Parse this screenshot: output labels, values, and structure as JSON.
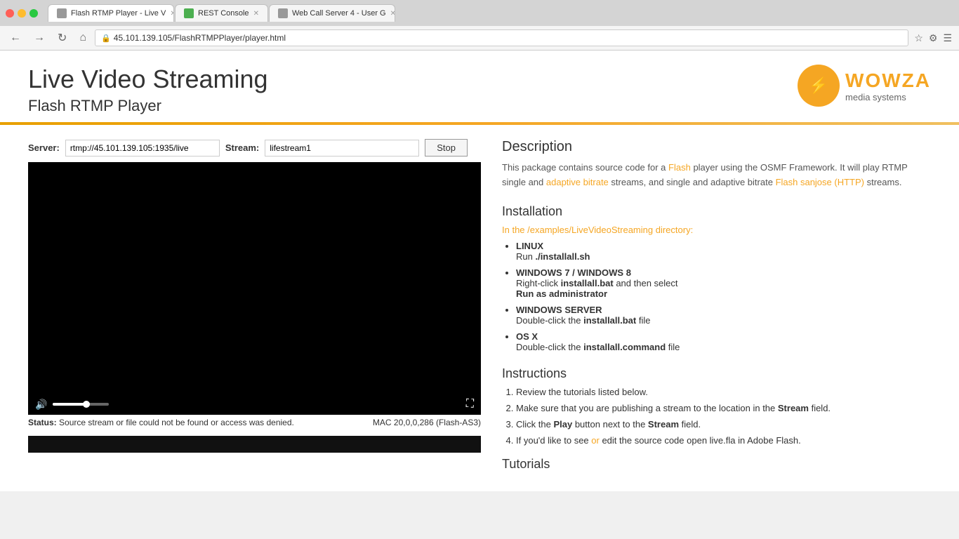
{
  "browser": {
    "tabs": [
      {
        "id": "tab1",
        "label": "Flash RTMP Player - Live V",
        "active": true,
        "favicon": "page"
      },
      {
        "id": "tab2",
        "label": "REST Console",
        "active": false,
        "favicon": "green"
      },
      {
        "id": "tab3",
        "label": "Web Call Server 4 - User G",
        "active": false,
        "favicon": "page"
      }
    ],
    "address": "45.101.139.105/FlashRTMPPlayer/player.html"
  },
  "page": {
    "title": "Live Video Streaming",
    "subtitle": "Flash RTMP Player",
    "orange_bar_visible": true
  },
  "wowza": {
    "brand": "WOWZA",
    "tagline": "media systems"
  },
  "player": {
    "server_label": "Server:",
    "server_value": "rtmp://45.101.139.105:1935/live",
    "stream_label": "Stream:",
    "stream_value": "lifestream1",
    "stop_button": "Stop",
    "status_label": "Status:",
    "status_text": "Source stream or file could not be found or access was denied.",
    "flash_version": "MAC 20,0,0,286 (Flash-AS3)"
  },
  "description": {
    "heading": "Description",
    "text_parts": [
      "This package contains source code for a Flash player using the OSMF Framework. It will play RTMP single and adaptive bitrate streams, and single and adaptive bitrate Flash sanjose (HTTP) streams."
    ]
  },
  "installation": {
    "heading": "Installation",
    "intro": "In the /examples/LiveVideoStreaming directory:",
    "items": [
      {
        "title": "LINUX",
        "detail": "Run ./installall.sh",
        "code": "./installall.sh"
      },
      {
        "title": "WINDOWS 7 / WINDOWS 8",
        "detail": "Right-click installall.bat and then select Run as administrator",
        "code": "installall.bat",
        "extra": "Run as administrator"
      },
      {
        "title": "WINDOWS SERVER",
        "detail": "Double-click the installall.bat file",
        "code": "installall.bat"
      },
      {
        "title": "OS X",
        "detail": "Double-click the installall.command file",
        "code": "installall.command"
      }
    ]
  },
  "instructions": {
    "heading": "Instructions",
    "items": [
      "Review the tutorials listed below.",
      "Make sure that you are publishing a stream to the location in the Stream field.",
      "Click the Play button next to the Stream field.",
      "If you'd like to see or edit the source code open live.fla in Adobe Flash."
    ]
  },
  "tutorials_heading": "Tutorials"
}
